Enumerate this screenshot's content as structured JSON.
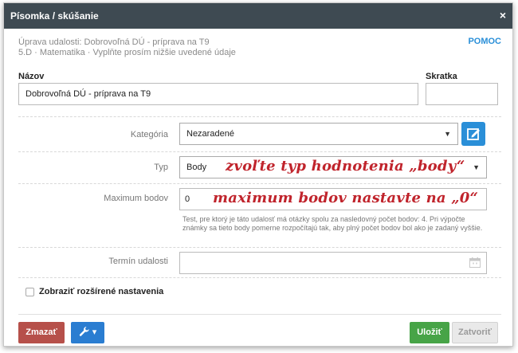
{
  "window": {
    "title": "Písomka / skúšanie",
    "close_symbol": "×"
  },
  "header": {
    "subtitle_line1": "Úprava udalosti: Dobrovoľná DÚ - príprava na T9",
    "subtitle_line2": "5.D · Matematika · Vyplňte prosím nižšie uvedené údaje",
    "help_label": "POMOC"
  },
  "fields": {
    "name_label": "Názov",
    "name_value": "Dobrovoľná DÚ - príprava na T9",
    "abbr_label": "Skratka",
    "abbr_value": "",
    "category_label": "Kategória",
    "category_value": "Nezaradené",
    "type_label": "Typ",
    "type_value": "Body",
    "max_points_label": "Maximum bodov",
    "max_points_value": "0",
    "hint_text": "Test, pre ktorý je táto udalosť má otázky spolu za nasledovný počet bodov: 4. Pri výpočte známky sa tieto body pomerne rozpočítajú tak, aby plný počet bodov bol ako je zadaný vyššie.",
    "date_label": "Termín udalosti",
    "date_value": ""
  },
  "annotations": {
    "type_note": "zvoľte typ hodnotenia „body“",
    "points_note": "maximum bodov nastavte na „0“"
  },
  "extended": {
    "label": "Zobraziť rozšírené nastavenia",
    "checked": false
  },
  "footer": {
    "delete_label": "Zmazať",
    "tools_caret": "▾",
    "save_label": "Uložiť",
    "close_label": "Zatvoriť"
  },
  "icons": {
    "edit": "edit-icon",
    "wrench": "wrench-icon",
    "calendar": "calendar-icon",
    "select_caret": "▼"
  },
  "colors": {
    "titlebar": "#3e4a52",
    "primary": "#2a8fd8",
    "danger": "#b6504a",
    "success": "#47a447",
    "annotation": "#c0242c"
  }
}
